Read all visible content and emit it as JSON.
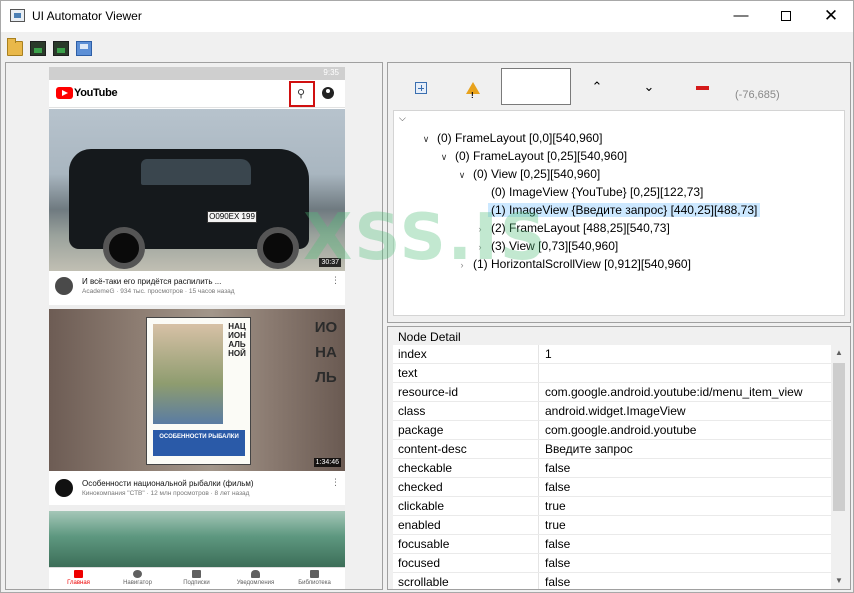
{
  "window": {
    "title": "UI Automator Viewer"
  },
  "toolbar": {
    "icons": [
      "open-folder-icon",
      "device-screenshot-icon",
      "device-screenshot-compressed-icon",
      "save-icon"
    ]
  },
  "phone": {
    "status_time": "9:35",
    "app_name": "YouTube",
    "videos": [
      {
        "title": "И всё-таки его придётся распилить ...",
        "subtitle": "AcademeG · 934 тыс. просмотров · 15 часов назад",
        "duration": "30:37",
        "plate": "О090ЕХ 199",
        "avatar_color": "#4a4a4a"
      },
      {
        "title": "Особенности национальной рыбалки (фильм)",
        "subtitle": "Кинокомпания \"СТВ\" · 12 млн просмотров · 8 лет назад",
        "duration": "1:34:46",
        "avatar_color": "#111111",
        "poster_vertical_text": "НАЦИОНАЛЬНОЙ",
        "poster_caption": "ОСОБЕННОСТИ РЫБАЛКИ",
        "side_text": "ИОНАЛЬ"
      }
    ],
    "nav": [
      {
        "label": "Главная",
        "active": true
      },
      {
        "label": "Навигатор",
        "active": false
      },
      {
        "label": "Подписки",
        "active": false
      },
      {
        "label": "Уведомления",
        "active": false
      },
      {
        "label": "Библиотека",
        "active": false
      }
    ]
  },
  "controls": {
    "filter_value": "",
    "coords": "(-76,685)"
  },
  "tree": {
    "nodes": [
      {
        "label": "(0) FrameLayout [0,0][540,960]",
        "depth": 1,
        "arrow": "open",
        "selected": false
      },
      {
        "label": "(0) FrameLayout [0,25][540,960]",
        "depth": 2,
        "arrow": "open",
        "selected": false
      },
      {
        "label": "(0) View [0,25][540,960]",
        "depth": 3,
        "arrow": "open",
        "selected": false
      },
      {
        "label": "(0) ImageView {YouTube} [0,25][122,73]",
        "depth": 4,
        "arrow": "none",
        "selected": false
      },
      {
        "label": "(1) ImageView {Введите запрос} [440,25][488,73]",
        "depth": 4,
        "arrow": "none",
        "selected": true
      },
      {
        "label": "(2) FrameLayout [488,25][540,73]",
        "depth": 4,
        "arrow": "collapsed",
        "selected": false
      },
      {
        "label": "(3) View [0,73][540,960]",
        "depth": 4,
        "arrow": "collapsed",
        "selected": false
      },
      {
        "label": "(1) HorizontalScrollView [0,912][540,960]",
        "depth": 3,
        "arrow": "collapsed",
        "selected": false
      }
    ]
  },
  "watermark": "XSS.IS",
  "node_detail": {
    "title": "Node Detail",
    "rows": [
      {
        "key": "index",
        "value": "1"
      },
      {
        "key": "text",
        "value": ""
      },
      {
        "key": "resource-id",
        "value": "com.google.android.youtube:id/menu_item_view"
      },
      {
        "key": "class",
        "value": "android.widget.ImageView"
      },
      {
        "key": "package",
        "value": "com.google.android.youtube"
      },
      {
        "key": "content-desc",
        "value": "Введите запрос"
      },
      {
        "key": "checkable",
        "value": "false"
      },
      {
        "key": "checked",
        "value": "false"
      },
      {
        "key": "clickable",
        "value": "true"
      },
      {
        "key": "enabled",
        "value": "true"
      },
      {
        "key": "focusable",
        "value": "false"
      },
      {
        "key": "focused",
        "value": "false"
      },
      {
        "key": "scrollable",
        "value": "false"
      }
    ]
  }
}
